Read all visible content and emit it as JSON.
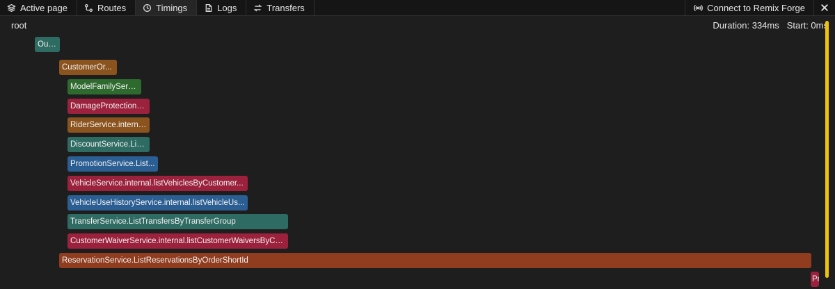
{
  "tabs": [
    {
      "label": "Active page",
      "icon": "layers-icon",
      "active": false
    },
    {
      "label": "Routes",
      "icon": "routes-icon",
      "active": false
    },
    {
      "label": "Timings",
      "icon": "clock-icon",
      "active": true
    },
    {
      "label": "Logs",
      "icon": "file-icon",
      "active": false
    },
    {
      "label": "Transfers",
      "icon": "arrows-icon",
      "active": false
    }
  ],
  "forge": {
    "label": "Connect to Remix Forge",
    "icon": "broadcast-icon"
  },
  "close_icon": "close-icon",
  "timeline": {
    "root_label": "root",
    "duration": "Duration: 334ms",
    "start": "Start: 0ms"
  },
  "spans": [
    {
      "label": "Out...",
      "color": "#2e6b62"
    },
    {
      "label": "CustomerOr...",
      "color": "#8b531d"
    },
    {
      "label": "ModelFamilyServi...",
      "color": "#2e6a2e"
    },
    {
      "label": "DamageProtectionP...",
      "color": "#9b213c"
    },
    {
      "label": "RiderService.interna...",
      "color": "#8b531d"
    },
    {
      "label": "DiscountService.Lis...",
      "color": "#2e6b62"
    },
    {
      "label": "PromotionService.List...",
      "color": "#2b5e93"
    },
    {
      "label": "VehicleService.internal.listVehiclesByCustomer...",
      "color": "#9b213c"
    },
    {
      "label": "VehicleUseHistoryService.internal.listVehicleUs...",
      "color": "#2b5e93"
    },
    {
      "label": "TransferService.ListTransfersByTransferGroup",
      "color": "#2e6b62"
    },
    {
      "label": "CustomerWaiverService.internal.listCustomerWaiversByCus...",
      "color": "#9b213c"
    },
    {
      "label": "ReservationService.ListReservationsByOrderShortId",
      "color": "#903c1f"
    },
    {
      "label": "Pr",
      "color": "#9b213c"
    }
  ]
}
